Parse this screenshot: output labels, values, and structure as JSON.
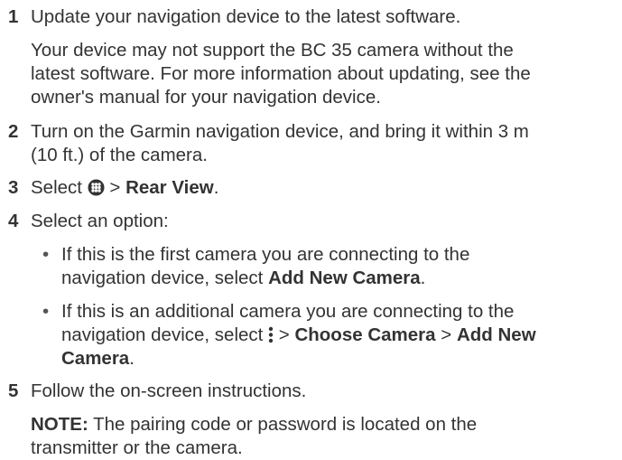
{
  "steps": [
    {
      "num": "1",
      "text": "Update your navigation device to the latest software.",
      "detail_lines": [
        "Your device may not support the BC 35 camera without the",
        "latest software. For more information about updating, see the",
        "owner's manual for your navigation device."
      ]
    },
    {
      "num": "2",
      "lines": [
        "Turn on the Garmin navigation device, and bring it within 3 m",
        "(10 ft.) of the camera."
      ]
    },
    {
      "num": "3",
      "prefix": "Select",
      "gt1": ">",
      "bold": "Rear View",
      "period": ".",
      "icon": "apps-icon"
    },
    {
      "num": "4",
      "text": "Select an option:",
      "bullets": [
        {
          "line1": "If this is the first camera you are connecting to the",
          "line2_prefix": "navigation device, select",
          "line2_bold": "Add New Camera",
          "line2_suffix": "."
        },
        {
          "line1": "If this is an additional camera you are connecting to the",
          "line2_prefix": "navigation device, select",
          "icon": "vertical-dots-menu-icon",
          "gt1": ">",
          "bold1": "Choose Camera",
          "gt2": ">",
          "bold2a": "Add New",
          "bold2b": "Camera",
          "suffix": "."
        }
      ],
      "bullet_char": "•"
    },
    {
      "num": "5",
      "text": "Follow the on-screen instructions.",
      "note_label": "NOTE:",
      "note_line1": " The pairing code or password is located on the",
      "note_line2": "transmitter or the camera."
    }
  ]
}
